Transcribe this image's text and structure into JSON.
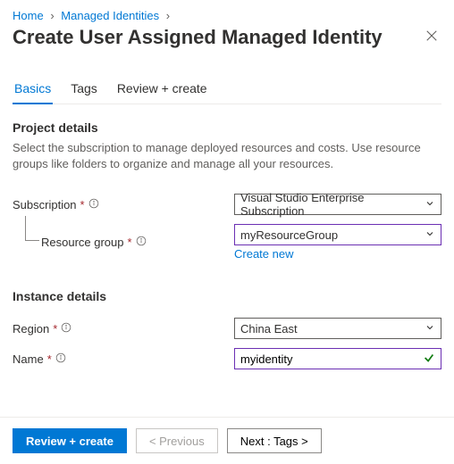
{
  "breadcrumb": {
    "home": "Home",
    "managed_identities": "Managed Identities"
  },
  "page_title": "Create User Assigned Managed Identity",
  "tabs": [
    {
      "label": "Basics",
      "active": true
    },
    {
      "label": "Tags",
      "active": false
    },
    {
      "label": "Review + create",
      "active": false
    }
  ],
  "sections": {
    "project_details": {
      "title": "Project details",
      "description": "Select the subscription to manage deployed resources and costs. Use resource groups like folders to organize and manage all your resources."
    },
    "instance_details": {
      "title": "Instance details"
    }
  },
  "fields": {
    "subscription": {
      "label": "Subscription",
      "value": "Visual Studio Enterprise Subscription"
    },
    "resource_group": {
      "label": "Resource group",
      "value": "myResourceGroup",
      "create_new": "Create new"
    },
    "region": {
      "label": "Region",
      "value": "China East"
    },
    "name": {
      "label": "Name",
      "value": "myidentity"
    }
  },
  "footer": {
    "review_create": "Review + create",
    "previous": "< Previous",
    "next": "Next : Tags >"
  }
}
